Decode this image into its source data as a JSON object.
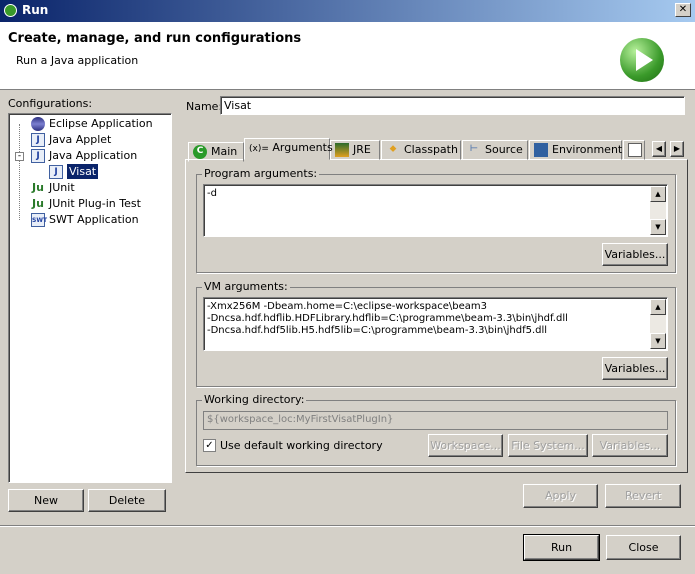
{
  "window": {
    "title": "Run",
    "close": "✕"
  },
  "header": {
    "title": "Create, manage, and run configurations",
    "subtitle": "Run a Java application",
    "icon": "run-play-icon",
    "accent": "#3a9a2a"
  },
  "configurations": {
    "label": "Configurations:",
    "items": [
      {
        "label": "Eclipse Application",
        "icon": "eclipse-icon"
      },
      {
        "label": "Java Applet",
        "icon": "java-applet-icon"
      },
      {
        "label": "Java Application",
        "icon": "java-application-icon",
        "expanded": true,
        "children": [
          {
            "label": "Visat",
            "icon": "java-icon",
            "selected": true
          }
        ]
      },
      {
        "label": "JUnit",
        "icon": "junit-icon"
      },
      {
        "label": "JUnit Plug-in Test",
        "icon": "junit-plugin-icon"
      },
      {
        "label": "SWT Application",
        "icon": "swt-icon"
      }
    ],
    "new_label": "New",
    "delete_label": "Delete"
  },
  "name": {
    "label": "Name:",
    "value": "Visat"
  },
  "tabs": [
    {
      "label": "Main"
    },
    {
      "label": "Arguments",
      "active": true
    },
    {
      "label": "JRE"
    },
    {
      "label": "Classpath"
    },
    {
      "label": "Source"
    },
    {
      "label": "Environment"
    },
    {
      "label": ""
    }
  ],
  "program_args": {
    "label": "Program arguments:",
    "value": "-d",
    "variables": "Variables..."
  },
  "vm_args": {
    "label": "VM arguments:",
    "lines": [
      "-Xmx256M -Dbeam.home=C:\\eclipse-workspace\\beam3",
      "-Dncsa.hdf.hdflib.HDFLibrary.hdflib=C:\\programme\\beam-3.3\\bin\\jhdf.dll",
      "-Dncsa.hdf.hdf5lib.H5.hdf5lib=C:\\programme\\beam-3.3\\bin\\jhdf5.dll"
    ],
    "variables": "Variables..."
  },
  "working_dir": {
    "label": "Working directory:",
    "value": "${workspace_loc:MyFirstVisatPlugIn}",
    "use_default_label": "Use default working directory",
    "use_default": true,
    "workspace": "Workspace...",
    "file_system": "File System...",
    "variables": "Variables..."
  },
  "actions": {
    "apply": "Apply",
    "revert": "Revert",
    "run": "Run",
    "close": "Close"
  }
}
